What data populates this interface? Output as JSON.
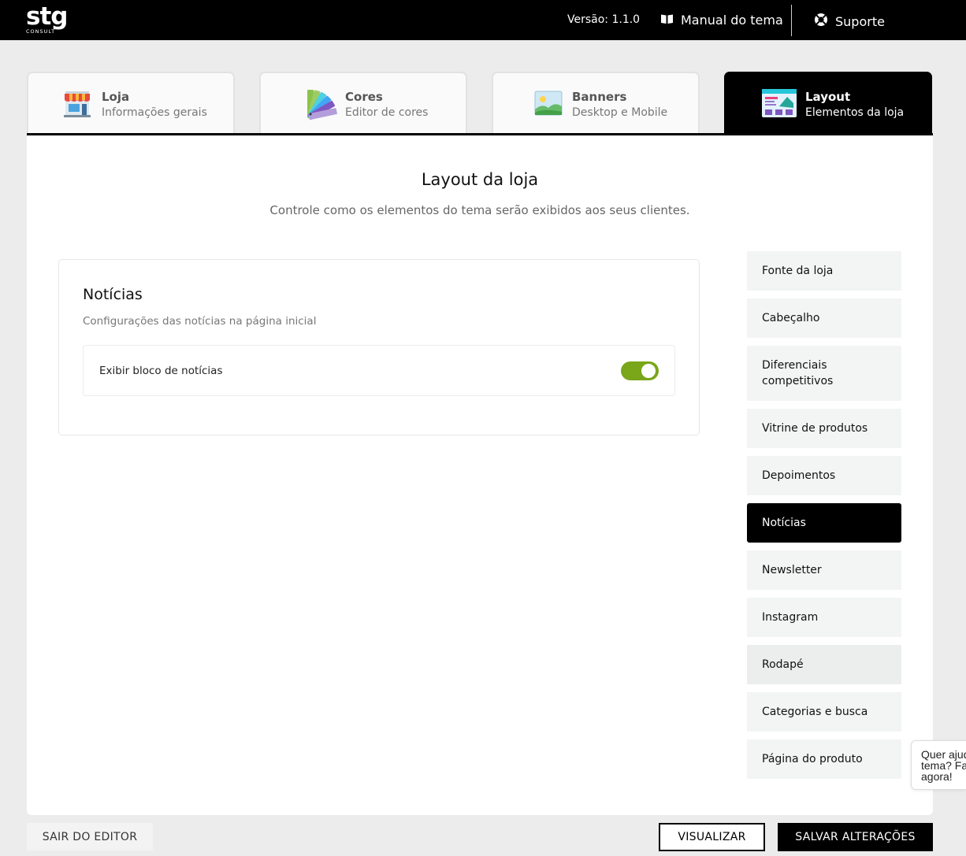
{
  "header": {
    "logo_text": "stg",
    "logo_sub": "CONSULT",
    "version": "Versão: 1.1.0",
    "manual_label": "Manual do tema",
    "support_label": "Suporte"
  },
  "tabs": [
    {
      "title": "Loja",
      "subtitle": "Informações gerais",
      "icon": "store-icon"
    },
    {
      "title": "Cores",
      "subtitle": "Editor de cores",
      "icon": "color-palette-icon"
    },
    {
      "title": "Banners",
      "subtitle": "Desktop e Mobile",
      "icon": "landscape-image-icon"
    },
    {
      "title": "Layout",
      "subtitle": "Elementos da loja",
      "icon": "layout-screen-icon",
      "active": true
    }
  ],
  "main": {
    "title": "Layout da loja",
    "subtitle": "Controle como os elementos do tema serão exibidos aos seus clientes."
  },
  "card": {
    "title": "Notícias",
    "subtitle": "Configurações das notícias na página inicial",
    "setting_label": "Exibir bloco de notícias",
    "setting_enabled": true
  },
  "side_nav": [
    {
      "label": "Fonte da loja"
    },
    {
      "label": "Cabeçalho"
    },
    {
      "label": "Diferenciais competitivos"
    },
    {
      "label": "Vitrine de produtos"
    },
    {
      "label": "Depoimentos"
    },
    {
      "label": "Notícias",
      "active": true
    },
    {
      "label": "Newsletter"
    },
    {
      "label": "Instagram"
    },
    {
      "label": "Rodapé"
    },
    {
      "label": "Categorias e busca"
    },
    {
      "label": "Página do produto"
    }
  ],
  "footer": {
    "exit_label": "SAIR DO EDITOR",
    "view_label": "VISUALIZAR",
    "save_label": "SALVAR ALTERAÇÕES"
  },
  "help_bubble": {
    "line1": "Quer ajuda com o",
    "line2": "tema? Fale com a gente",
    "line3": "agora!"
  },
  "colors": {
    "accent": "#000000",
    "toggle_on": "#7aa61a",
    "nav_bg": "#f3f5f5"
  }
}
